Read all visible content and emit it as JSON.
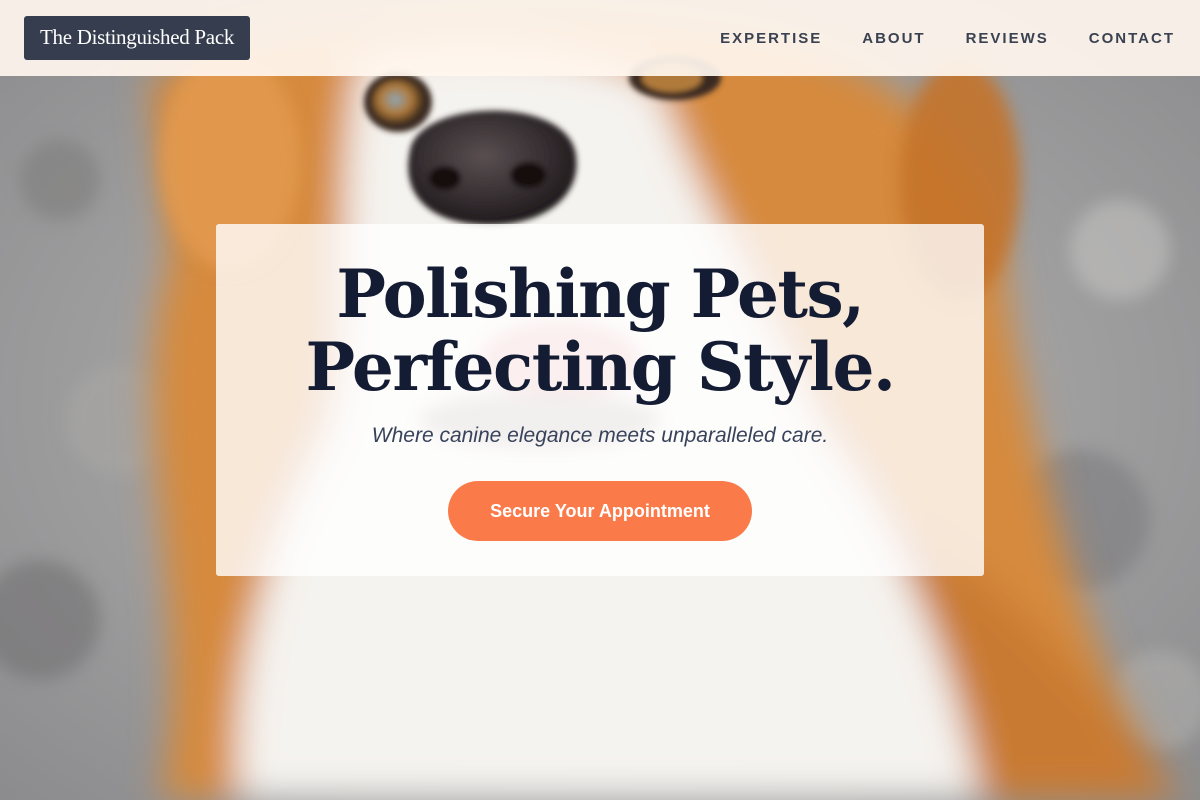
{
  "header": {
    "brand": "The Distinguished Pack",
    "nav": [
      {
        "label": "EXPERTISE"
      },
      {
        "label": "ABOUT"
      },
      {
        "label": "REVIEWS"
      },
      {
        "label": "CONTACT"
      }
    ]
  },
  "hero": {
    "title_line1": "Polishing Pets,",
    "title_line2": "Perfecting Style.",
    "subtitle": "Where canine elegance meets unparalleled care.",
    "cta_label": "Secure Your Appointment"
  },
  "colors": {
    "header_bg": "#fff6ee",
    "brand_bg": "#353d4e",
    "title_text": "#141c33",
    "cta_bg": "#fa7a4a",
    "dog_fur_orange": "#d9873c",
    "dog_fur_white": "#f5f3ef"
  },
  "background_image": "dog-hero-photo"
}
